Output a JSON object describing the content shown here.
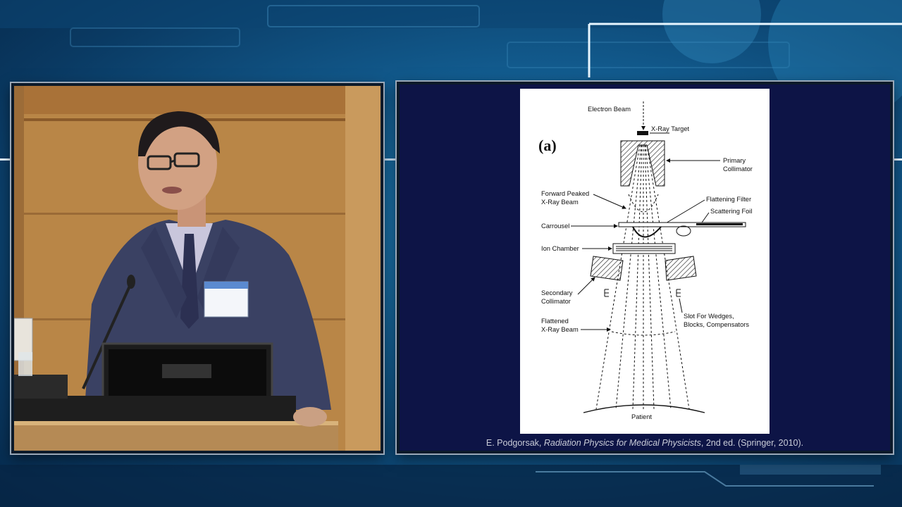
{
  "slide": {
    "figure_tag": "(a)",
    "labels": {
      "electron_beam": "Electron Beam",
      "xray_target": "X-Ray Target",
      "primary_collimator_1": "Primary",
      "primary_collimator_2": "Collimator",
      "forward_peaked_1": "Forward Peaked",
      "forward_peaked_2": "X-Ray Beam",
      "flattening_filter": "Flattening Filter",
      "scattering_foil": "Scattering Foil",
      "carrousel": "Carrousel",
      "ion_chamber": "Ion Chamber",
      "secondary_collimator_1": "Secondary",
      "secondary_collimator_2": "Collimator",
      "slot_1": "Slot For Wedges,",
      "slot_2": "Blocks, Compensators",
      "flattened_1": "Flattened",
      "flattened_2": "X-Ray Beam",
      "patient": "Patient"
    },
    "caption": {
      "author": "E. Podgorsak, ",
      "title": "Radiation Physics for Medical Physicists",
      "rest": ", 2nd ed. (Springer, 2010)."
    }
  },
  "speaker": {
    "badge_icon": "name-badge",
    "scene": "presenter-at-podium"
  },
  "colors": {
    "slide_background": "#0d1446",
    "page_background": "#ffffff",
    "wall": "#b07c43"
  }
}
